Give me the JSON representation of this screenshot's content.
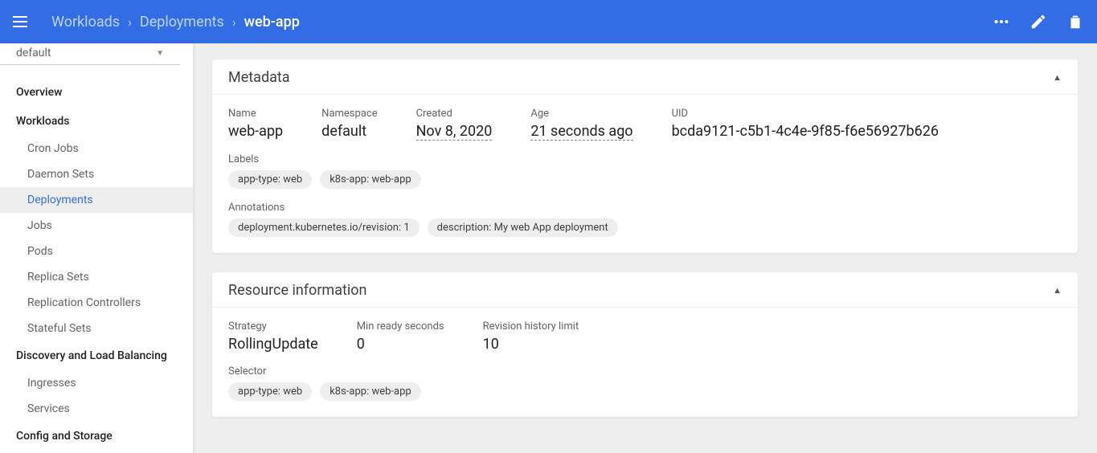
{
  "breadcrumbs": {
    "crumb1": "Workloads",
    "crumb2": "Deployments",
    "current": "web-app"
  },
  "namespace_selector": {
    "value": "default"
  },
  "sidebar": {
    "overview": "Overview",
    "workloads": "Workloads",
    "workloads_items": {
      "cronjobs": "Cron Jobs",
      "daemonsets": "Daemon Sets",
      "deployments": "Deployments",
      "jobs": "Jobs",
      "pods": "Pods",
      "replicasets": "Replica Sets",
      "replicationcontrollers": "Replication Controllers",
      "statefulsets": "Stateful Sets"
    },
    "discovery": "Discovery and Load Balancing",
    "discovery_items": {
      "ingresses": "Ingresses",
      "services": "Services"
    },
    "config": "Config and Storage"
  },
  "metadata": {
    "title": "Metadata",
    "name_label": "Name",
    "name_value": "web-app",
    "namespace_label": "Namespace",
    "namespace_value": "default",
    "created_label": "Created",
    "created_value": "Nov 8, 2020",
    "age_label": "Age",
    "age_value": "21 seconds ago",
    "uid_label": "UID",
    "uid_value": "bcda9121-c5b1-4c4e-9f85-f6e56927b626",
    "labels_label": "Labels",
    "labels": {
      "l1": "app-type: web",
      "l2": "k8s-app: web-app"
    },
    "annotations_label": "Annotations",
    "annotations": {
      "a1": "deployment.kubernetes.io/revision: 1",
      "a2": "description: My web App deployment"
    }
  },
  "resource": {
    "title": "Resource information",
    "strategy_label": "Strategy",
    "strategy_value": "RollingUpdate",
    "minready_label": "Min ready seconds",
    "minready_value": "0",
    "revision_label": "Revision history limit",
    "revision_value": "10",
    "selector_label": "Selector",
    "selectors": {
      "s1": "app-type: web",
      "s2": "k8s-app: web-app"
    }
  }
}
